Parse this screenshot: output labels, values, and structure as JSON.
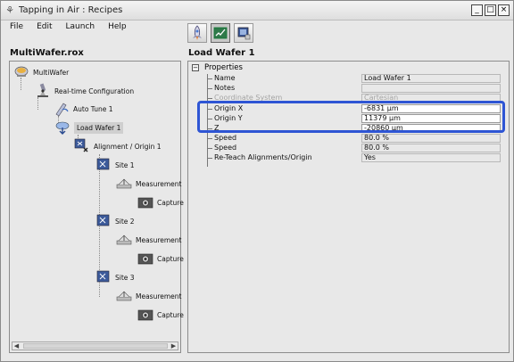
{
  "window": {
    "title": "Tapping in Air : Recipes",
    "buttons": [
      "_",
      "□",
      "×"
    ]
  },
  "menu": [
    "File",
    "Edit",
    "Launch",
    "Help"
  ],
  "toolbar": {
    "buttons": [
      {
        "name": "launch",
        "icon": "rocket-icon"
      },
      {
        "name": "view",
        "icon": "chart-check-icon"
      },
      {
        "name": "settings",
        "icon": "device-icon"
      }
    ]
  },
  "left_pane": {
    "title": "MultiWafer.rox",
    "tree": [
      {
        "label": "MultiWafer",
        "icon": "wafer-icon"
      },
      {
        "label": "Real-time Configuration",
        "icon": "microscope-icon"
      },
      {
        "label": "Auto Tune 1",
        "icon": "tune-icon"
      },
      {
        "label": "Load Wafer 1",
        "icon": "load-wafer-icon",
        "selected": true
      },
      {
        "label": "Alignment / Origin 1",
        "icon": "alignment-icon"
      },
      {
        "label": "Site 1",
        "icon": "site-icon"
      },
      {
        "label": "Measurement",
        "icon": "measurement-icon"
      },
      {
        "label": "Capture",
        "icon": "capture-icon"
      },
      {
        "label": "Site 2",
        "icon": "site-icon"
      },
      {
        "label": "Measurement",
        "icon": "measurement-icon"
      },
      {
        "label": "Capture",
        "icon": "capture-icon"
      },
      {
        "label": "Site 3",
        "icon": "site-icon"
      },
      {
        "label": "Measurement",
        "icon": "measurement-icon"
      },
      {
        "label": "Capture",
        "icon": "capture-icon"
      }
    ]
  },
  "right_pane": {
    "title": "Load Wafer 1",
    "section": "Properties",
    "collapse_symbol": "⊟",
    "properties": [
      {
        "name": "Name",
        "value": "Load Wafer 1",
        "disabled": false,
        "editable": false
      },
      {
        "name": "Notes",
        "value": "",
        "disabled": false,
        "editable": false
      },
      {
        "name": "Coordinate System",
        "value": "Cartesian",
        "disabled": true,
        "editable": false
      },
      {
        "name": "Origin X",
        "value": "-6831 µm",
        "disabled": false,
        "editable": true
      },
      {
        "name": "Origin Y",
        "value": "11379 µm",
        "disabled": false,
        "editable": true
      },
      {
        "name": "Z",
        "value": "-20860 µm",
        "disabled": false,
        "editable": true
      },
      {
        "name": "Speed",
        "value": "80.0 %",
        "disabled": false,
        "editable": false
      },
      {
        "name": "Speed",
        "value": "80.0 %",
        "disabled": false,
        "editable": false
      },
      {
        "name": "Re-Teach Alignments/Origin",
        "value": "Yes",
        "disabled": false,
        "editable": false
      }
    ]
  },
  "colors": {
    "highlight": "#2e55d4",
    "selected": "#cfcfcf"
  }
}
